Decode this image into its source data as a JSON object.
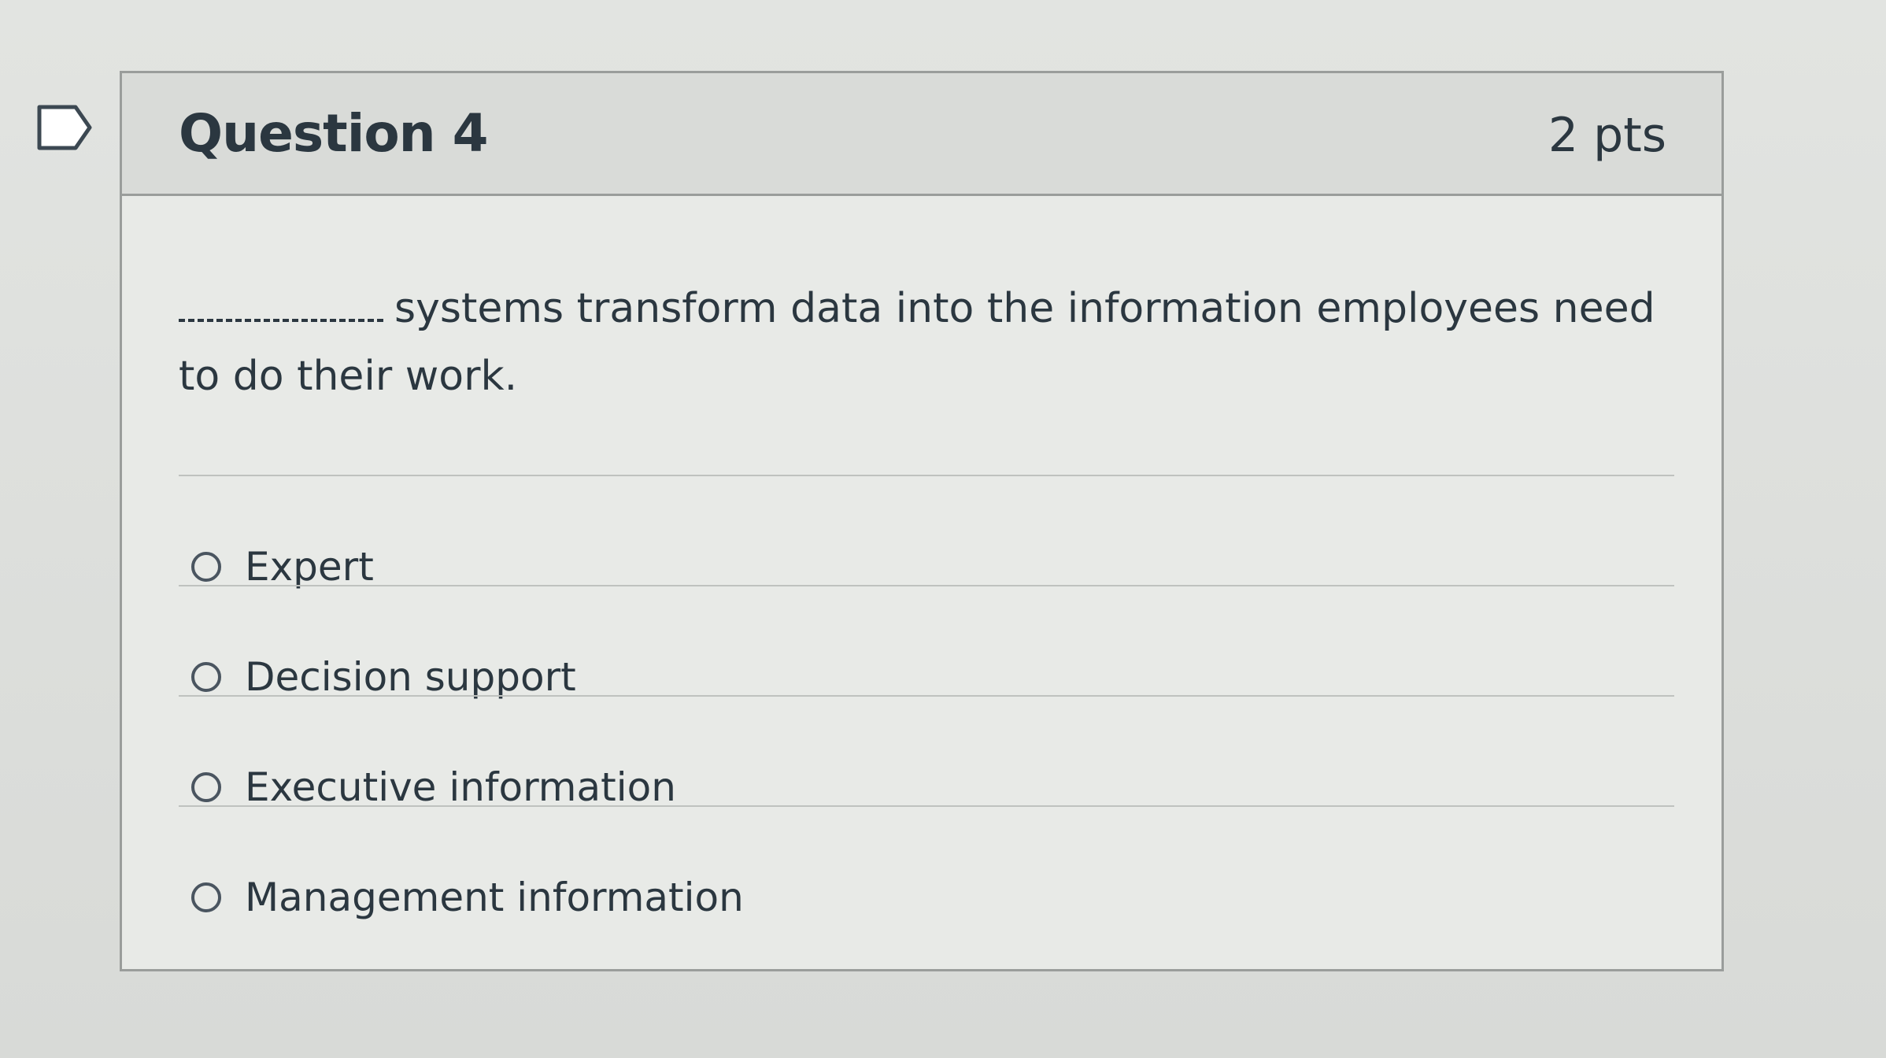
{
  "question": {
    "title": "Question 4",
    "points": "2 pts",
    "blank": "__________",
    "text": "systems transform data into the information employees need to do their work."
  },
  "answers": [
    {
      "label": "Expert",
      "selected": false
    },
    {
      "label": "Decision support",
      "selected": false
    },
    {
      "label": "Executive information",
      "selected": false
    },
    {
      "label": "Management information",
      "selected": false
    }
  ],
  "icons": {
    "flag": "flag-icon",
    "radio": "radio-unchecked-icon"
  },
  "colors": {
    "text": "#2b3740",
    "border": "#9a9d9b",
    "header_bg": "#d9dbd8"
  }
}
